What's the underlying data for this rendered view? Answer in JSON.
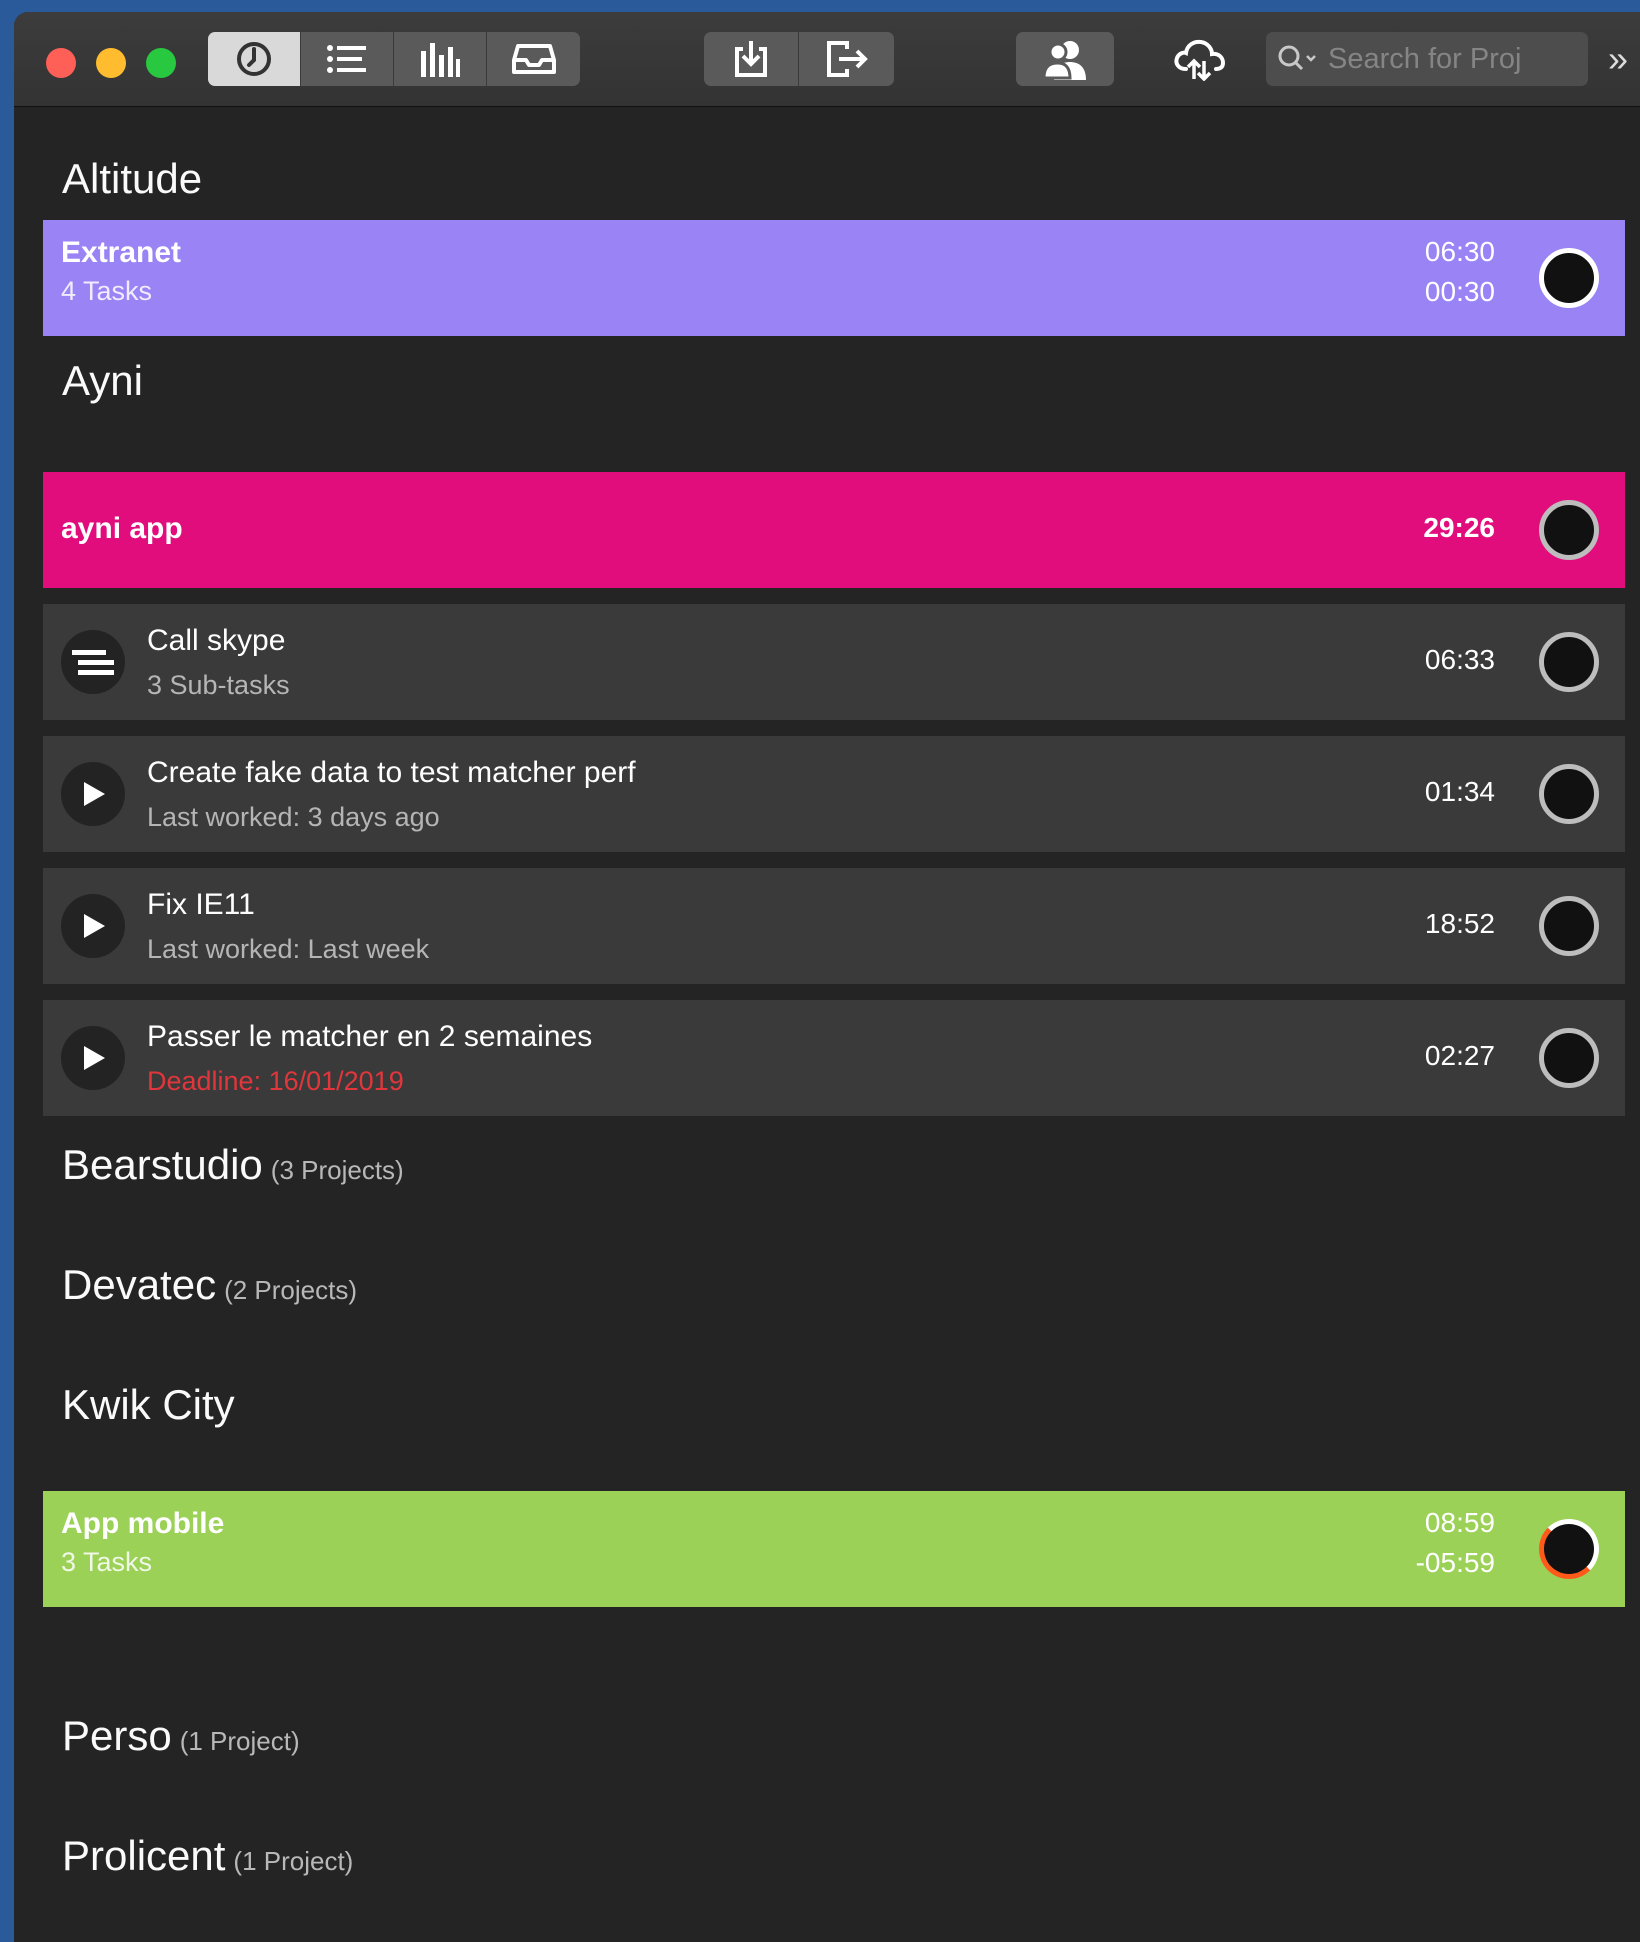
{
  "toolbar": {
    "tabs": [
      {
        "icon": "clock-icon",
        "active": true
      },
      {
        "icon": "list-icon",
        "active": false
      },
      {
        "icon": "bar-chart-icon",
        "active": false
      },
      {
        "icon": "inbox-icon",
        "active": false
      }
    ],
    "search_placeholder": "Search for Proj",
    "overflow_label": "»"
  },
  "groups": [
    {
      "name": "Altitude",
      "count": ""
    },
    {
      "name": "Ayni",
      "count": ""
    },
    {
      "name": "Bearstudio",
      "count": "(3 Projects)"
    },
    {
      "name": "Devatec",
      "count": "(2 Projects)"
    },
    {
      "name": "Kwik City",
      "count": ""
    },
    {
      "name": "Perso",
      "count": "(1 Project)"
    },
    {
      "name": "Prolicent",
      "count": "(1 Project)"
    }
  ],
  "projects": {
    "extranet": {
      "name": "Extranet",
      "sub": "4 Tasks",
      "time": "06:30",
      "time2": "00:30",
      "color": "#9a83f5"
    },
    "ayni_app": {
      "name": "ayni app",
      "time": "29:26",
      "color": "#e20d7c"
    },
    "app_mobile": {
      "name": "App mobile",
      "sub": "3 Tasks",
      "time": "08:59",
      "time2": "-05:59",
      "color": "#9bd157"
    }
  },
  "tasks": [
    {
      "title": "Call skype",
      "meta": "3 Sub-tasks",
      "time": "06:33",
      "icon": "subtasks-icon"
    },
    {
      "title": "Create fake data to test matcher perf",
      "meta": "Last worked: 3 days ago",
      "time": "01:34",
      "icon": "play-icon"
    },
    {
      "title": "Fix IE11",
      "meta": "Last worked: Last week",
      "time": "18:52",
      "icon": "play-icon"
    },
    {
      "title": "Passer le matcher en 2 semaines",
      "meta": "Deadline: 16/01/2019",
      "time": "02:27",
      "icon": "play-icon"
    }
  ]
}
